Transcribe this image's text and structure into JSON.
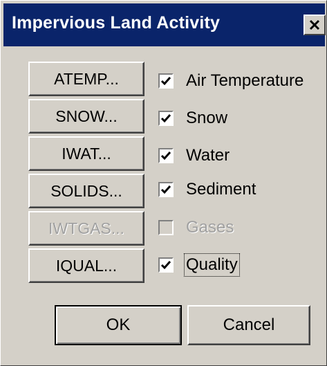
{
  "window": {
    "title": "Impervious Land Activity",
    "close_icon": "close-icon"
  },
  "sections": [
    {
      "button": "ATEMP...",
      "label": "Air Temperature",
      "checked": true,
      "enabled": true
    },
    {
      "button": "SNOW...",
      "label": "Snow",
      "checked": true,
      "enabled": true
    },
    {
      "button": "IWAT...",
      "label": "Water",
      "checked": true,
      "enabled": true
    },
    {
      "button": "SOLIDS...",
      "label": "Sediment",
      "checked": true,
      "enabled": true
    },
    {
      "button": "IWTGAS...",
      "label": "Gases",
      "checked": false,
      "enabled": false
    },
    {
      "button": "IQUAL...",
      "label": "Quality",
      "checked": true,
      "enabled": true,
      "focused": true
    }
  ],
  "footer": {
    "ok_label": "OK",
    "cancel_label": "Cancel"
  },
  "colors": {
    "titlebar": "#0a246a",
    "face": "#d4d0c8",
    "disabled_text": "#a0a0a0"
  }
}
